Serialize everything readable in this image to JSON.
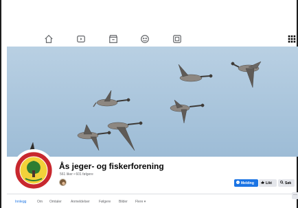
{
  "nav": {
    "icons": [
      "home-icon",
      "video-icon",
      "marketplace-icon",
      "groups-icon",
      "gaming-icon",
      "menu-grid-icon"
    ]
  },
  "cover": {
    "subject": "flock of geese flying in blue sky"
  },
  "page": {
    "name": "Ås jeger- og fiskerforening",
    "stats": "561 liker • 601 følgere"
  },
  "actions": {
    "message_label": "Melding",
    "like_label": "Likt",
    "search_label": "Søk",
    "more_label": "···"
  },
  "tabs": [
    {
      "label": "Innlegg",
      "active": true
    },
    {
      "label": "Om",
      "active": false
    },
    {
      "label": "Omtaler",
      "active": false
    },
    {
      "label": "Anmeldelser",
      "active": false
    },
    {
      "label": "Følgere",
      "active": false
    },
    {
      "label": "Bilder",
      "active": false
    },
    {
      "label": "Flere ▾",
      "active": false
    }
  ],
  "colors": {
    "accent": "#1b74e4",
    "sky": "#a8c4dc",
    "button_secondary": "#e4e6eb"
  }
}
